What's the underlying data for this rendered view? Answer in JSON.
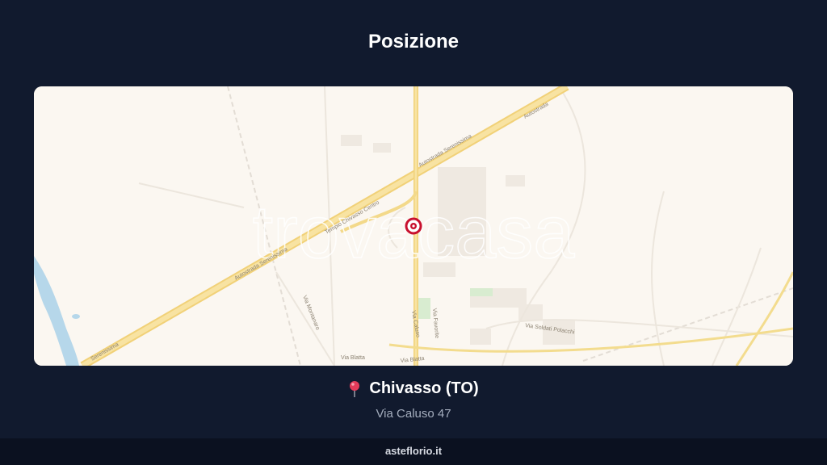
{
  "header": {
    "title": "Posizione"
  },
  "map": {
    "watermark": "trovacasa",
    "road_labels": {
      "autostrada_1": "Autostrada",
      "autostrada_2": "Autostrada Serenissima",
      "autostrada_3": "Autostrada Serenissima",
      "autostrada_4": "Serenissima",
      "tempio": "Tempio Chivasso Centro",
      "via_montanaro": "Via Montanaro",
      "via_caluso": "Via Caluso",
      "via_favorite": "Via Favorite",
      "via_soldati": "Via Soldati Polacchi",
      "via_blatta_1": "Via Blatta",
      "via_blatta_2": "Via Blatta"
    },
    "colors": {
      "marker": "#c8102e",
      "road": "#f6dc8a",
      "water": "#b6d7ea"
    },
    "marker_icon": "map-marker-icon"
  },
  "location": {
    "pin_icon": "pushpin-icon",
    "city": "Chivasso (TO)",
    "address": "Via Caluso 47"
  },
  "footer": {
    "brand": "asteflorio.it"
  }
}
